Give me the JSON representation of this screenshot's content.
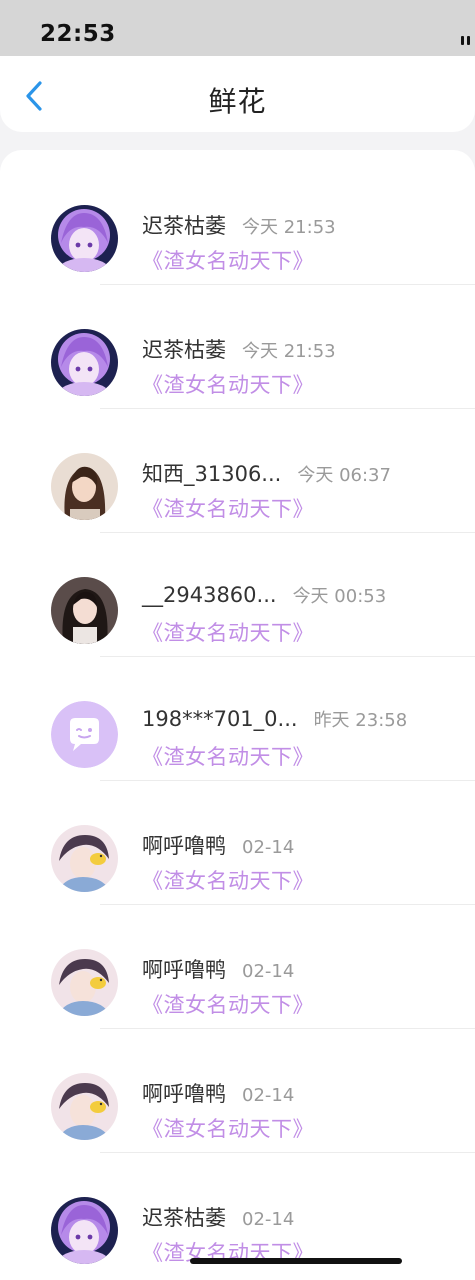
{
  "status_bar": {
    "time": "22:53"
  },
  "header": {
    "title": "鲜花"
  },
  "list": [
    {
      "name": "迟茶枯萎",
      "time": "今天 21:53",
      "title": "《渣女名动天下》",
      "avatar": "purple-anime-girl"
    },
    {
      "name": "迟茶枯萎",
      "time": "今天 21:53",
      "title": "《渣女名动天下》",
      "avatar": "purple-anime-girl"
    },
    {
      "name": "知西_31306...",
      "time": "今天 06:37",
      "title": "《渣女名动天下》",
      "avatar": "photo-woman-brown"
    },
    {
      "name": "__2943860...",
      "time": "今天 00:53",
      "title": "《渣女名动天下》",
      "avatar": "photo-woman-dark"
    },
    {
      "name": "198***701_0...",
      "time": "昨天 23:58",
      "title": "《渣女名动天下》",
      "avatar": "default-chat-bubble"
    },
    {
      "name": "啊呼噜鸭",
      "time": "02-14",
      "title": "《渣女名动天下》",
      "avatar": "anime-boy-duck"
    },
    {
      "name": "啊呼噜鸭",
      "time": "02-14",
      "title": "《渣女名动天下》",
      "avatar": "anime-boy-duck"
    },
    {
      "name": "啊呼噜鸭",
      "time": "02-14",
      "title": "《渣女名动天下》",
      "avatar": "anime-boy-duck"
    },
    {
      "name": "迟茶枯萎",
      "time": "02-14",
      "title": "《渣女名动天下》",
      "avatar": "purple-anime-girl"
    }
  ],
  "colors": {
    "accent": "#c18ee6",
    "back_icon": "#2b95e9",
    "time_text": "#9a9a9a"
  }
}
